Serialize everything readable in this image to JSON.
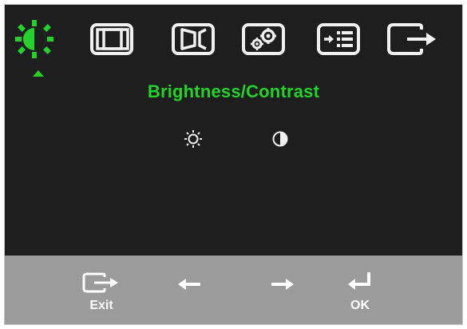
{
  "menu": {
    "tabs": [
      {
        "name": "brightness-contrast",
        "icon": "brightness-contrast-icon",
        "active": true
      },
      {
        "name": "image-position",
        "icon": "image-position-icon",
        "active": false
      },
      {
        "name": "image-setup",
        "icon": "image-setup-icon",
        "active": false
      },
      {
        "name": "image-properties",
        "icon": "image-properties-icon",
        "active": false
      },
      {
        "name": "options",
        "icon": "options-icon",
        "active": false
      },
      {
        "name": "exit",
        "icon": "exit-icon",
        "active": false
      }
    ],
    "active_color": "#23d32a",
    "inactive_color": "#f0f0f0"
  },
  "panel": {
    "title": "Brightness/Contrast",
    "items": [
      {
        "name": "brightness",
        "icon": "sun-icon"
      },
      {
        "name": "contrast",
        "icon": "contrast-icon"
      }
    ]
  },
  "controls": {
    "exit_label": "Exit",
    "ok_label": "OK",
    "left_icon": "arrow-left-icon",
    "right_icon": "arrow-right-icon"
  }
}
